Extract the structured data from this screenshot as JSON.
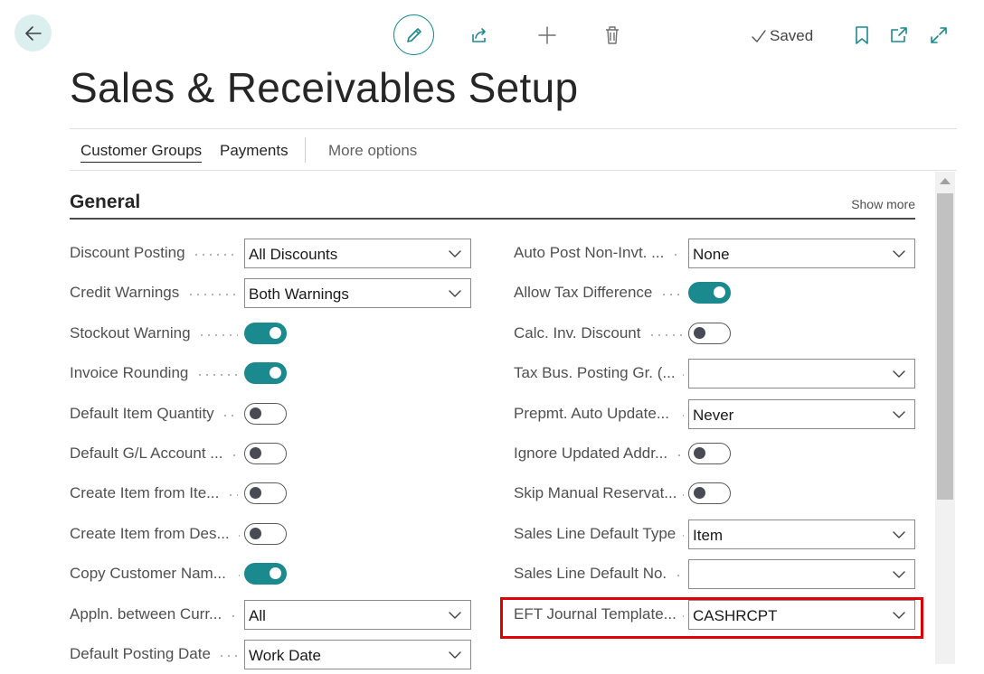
{
  "page": {
    "title": "Sales & Receivables Setup"
  },
  "toolbar": {
    "saved_label": "Saved"
  },
  "actions": {
    "customer_groups": "Customer Groups",
    "payments": "Payments",
    "more_options": "More options"
  },
  "group": {
    "title": "General",
    "show_more": "Show more"
  },
  "left_fields": [
    {
      "label": "Discount Posting",
      "type": "select",
      "value": "All Discounts"
    },
    {
      "label": "Credit Warnings",
      "type": "select",
      "value": "Both Warnings"
    },
    {
      "label": "Stockout Warning",
      "type": "toggle",
      "on": true
    },
    {
      "label": "Invoice Rounding",
      "type": "toggle",
      "on": true
    },
    {
      "label": "Default Item Quantity",
      "type": "toggle",
      "on": false
    },
    {
      "label": "Default G/L Account ...",
      "type": "toggle",
      "on": false
    },
    {
      "label": "Create Item from Ite...",
      "type": "toggle",
      "on": false
    },
    {
      "label": "Create Item from Des...",
      "type": "toggle",
      "on": false
    },
    {
      "label": "Copy Customer Nam...",
      "type": "toggle",
      "on": true
    },
    {
      "label": "Appln. between Curr...",
      "type": "select",
      "value": "All"
    },
    {
      "label": "Default Posting Date",
      "type": "select",
      "value": "Work Date"
    }
  ],
  "right_fields": [
    {
      "label": "Auto Post Non-Invt. ...",
      "type": "select",
      "value": "None"
    },
    {
      "label": "Allow Tax Difference",
      "type": "toggle",
      "on": true
    },
    {
      "label": "Calc. Inv. Discount",
      "type": "toggle",
      "on": false
    },
    {
      "label": "Tax Bus. Posting Gr. (...",
      "type": "select",
      "value": ""
    },
    {
      "label": "Prepmt. Auto Update...",
      "type": "select",
      "value": "Never"
    },
    {
      "label": "Ignore Updated Addr...",
      "type": "toggle",
      "on": false
    },
    {
      "label": "Skip Manual Reservat...",
      "type": "toggle",
      "on": false
    },
    {
      "label": "Sales Line Default Type",
      "type": "select",
      "value": "Item"
    },
    {
      "label": "Sales Line Default No.",
      "type": "select",
      "value": ""
    },
    {
      "label": "EFT Journal Template...",
      "type": "select",
      "value": "CASHRCPT"
    }
  ],
  "colors": {
    "accent": "#1b8a8e",
    "highlight": "#e00000"
  }
}
